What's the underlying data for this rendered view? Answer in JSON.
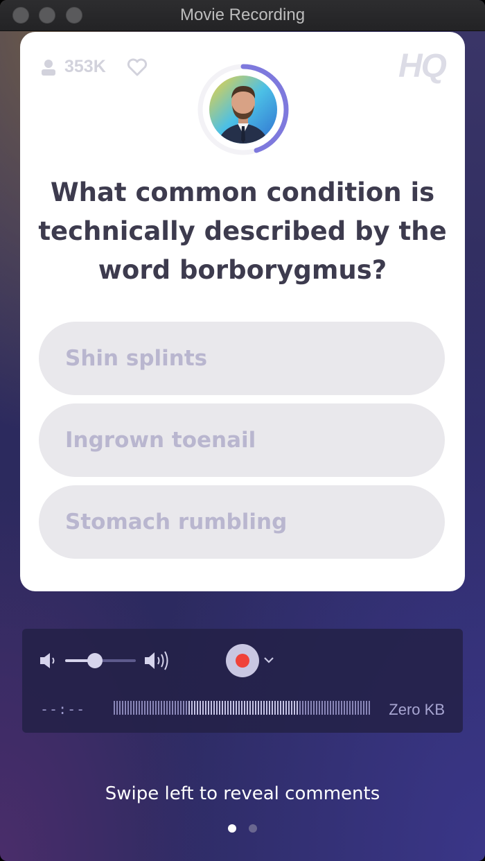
{
  "window": {
    "title": "Movie Recording"
  },
  "hq_card": {
    "viewer_count": "353K",
    "logo": "HQ",
    "timer_progress": 0.45,
    "question": "What common condition is technically described by the word borborygmus?",
    "answers": [
      "Shin splints",
      "Ingrown toenail",
      "Stomach rumbling"
    ]
  },
  "recorder": {
    "volume_level": 0.42,
    "elapsed_time": "--:--",
    "file_size": "Zero KB"
  },
  "footer": {
    "hint": "Swipe left to reveal comments",
    "pages": 2,
    "active_page": 1
  },
  "colors": {
    "accent": "#7e79dd",
    "record": "#f0433a"
  }
}
